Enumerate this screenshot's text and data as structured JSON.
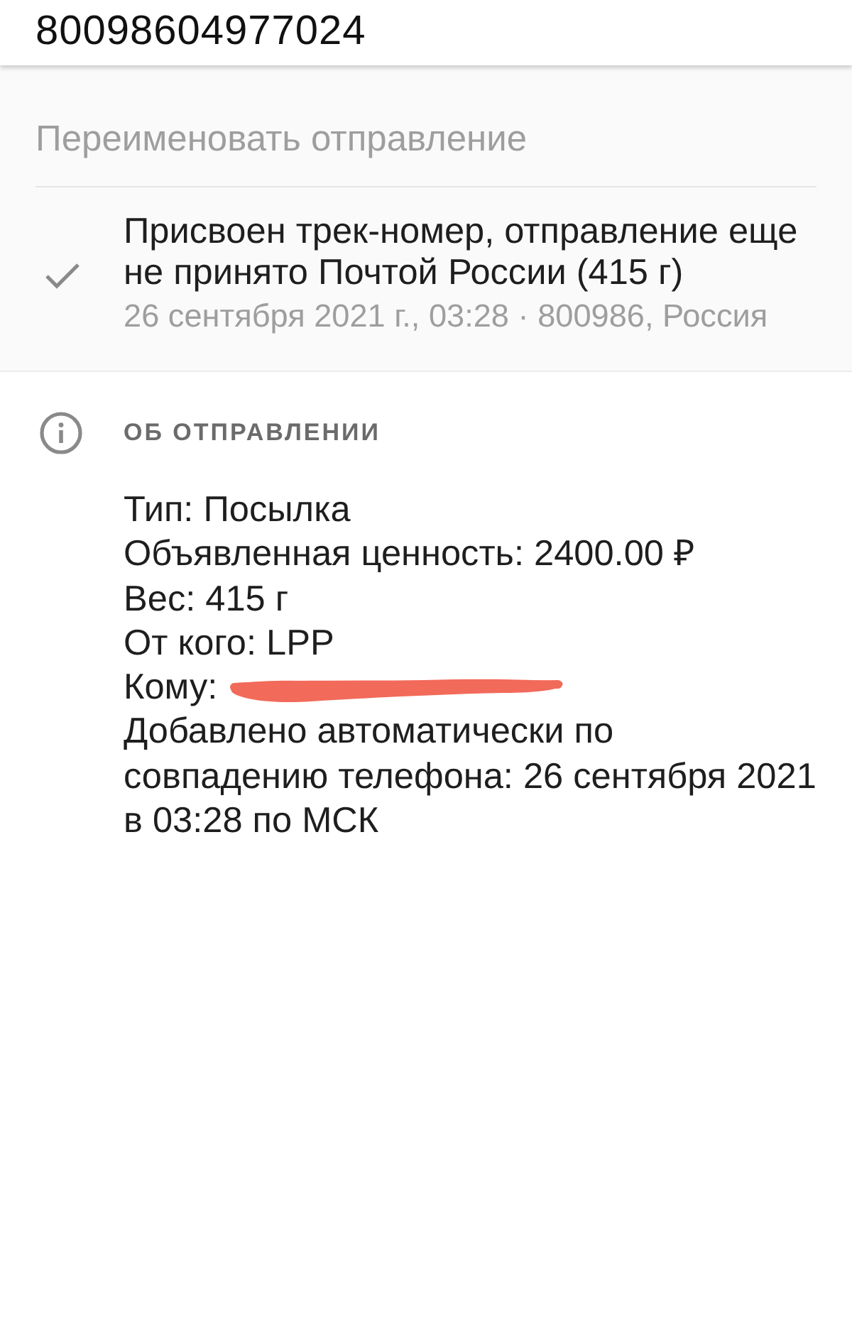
{
  "header": {
    "track_number": "80098604977024"
  },
  "rename": {
    "placeholder": "Переименовать отправление"
  },
  "events": [
    {
      "title": "Присвоен трек-номер, отправление еще не принято Почтой России (415 г)",
      "meta": "26 сентября 2021 г., 03:28 · 800986, Россия",
      "done": true
    }
  ],
  "about": {
    "heading": "ОБ ОТПРАВЛЕНИИ",
    "lines": [
      {
        "text": "Тип: Посылка",
        "redacted": false
      },
      {
        "text": "Объявленная ценность: 2400.00 ₽",
        "redacted": false
      },
      {
        "text": "Вес: 415 г",
        "redacted": false
      },
      {
        "text": "От кого: LPP",
        "redacted": false
      },
      {
        "text": "Кому:",
        "redacted": true
      },
      {
        "text": "Добавлено автоматически по совпадению телефона: 26 сентября 2021 в 03:28 по МСК",
        "redacted": false
      }
    ]
  }
}
